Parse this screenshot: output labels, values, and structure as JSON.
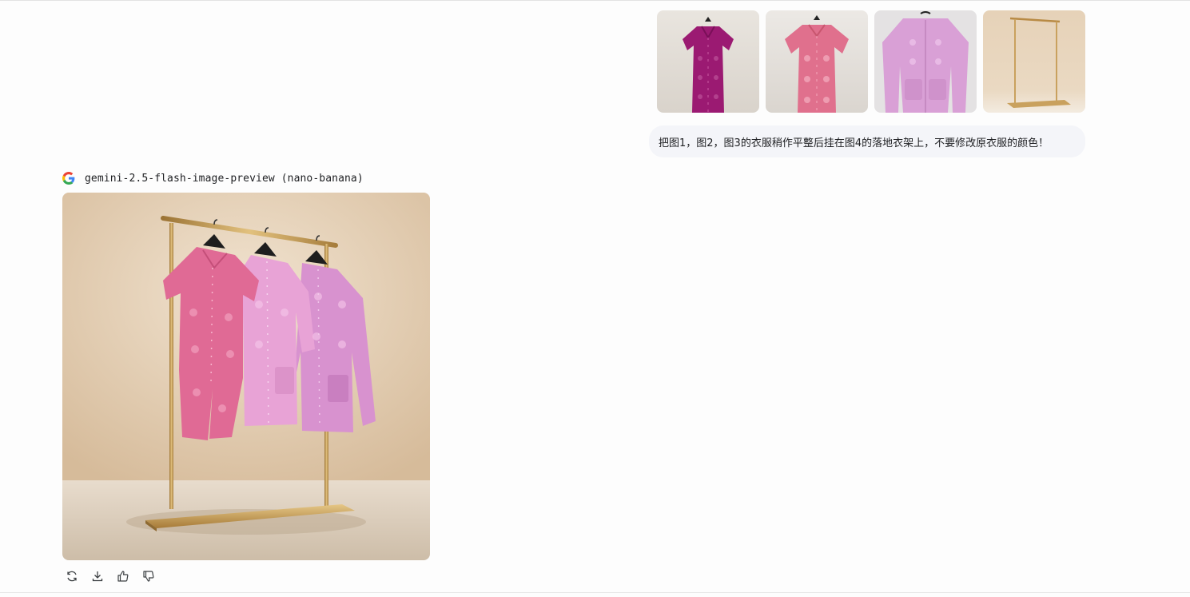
{
  "prompt": {
    "text": "把图1，图2，图3的衣服稍作平整后挂在图4的落地衣架上，不要修改原衣服的颜色！",
    "attachments": [
      {
        "icon": "magenta-dress-thumbnail"
      },
      {
        "icon": "pink-dress-thumbnail"
      },
      {
        "icon": "lilac-cardigan-thumbnail"
      },
      {
        "icon": "gold-clothing-rack-thumbnail"
      }
    ]
  },
  "response": {
    "model_label": "gemini-2.5-flash-image-preview (nano-banana)",
    "provider_icon": "google-g-icon",
    "image": "generated-rack-with-three-garments",
    "actions": [
      {
        "name": "regenerate",
        "icon": "refresh-icon"
      },
      {
        "name": "download",
        "icon": "download-icon"
      },
      {
        "name": "like",
        "icon": "thumbs-up-icon"
      },
      {
        "name": "dislike",
        "icon": "thumbs-down-icon"
      }
    ]
  },
  "colors": {
    "bubble_bg": "#f4f5f9",
    "text": "#202124",
    "magenta": "#9b1a72",
    "pink": "#e0708d",
    "lilac": "#d9a0d6",
    "gold": "#c9a15e",
    "backdrop": "#e8d4bd"
  }
}
